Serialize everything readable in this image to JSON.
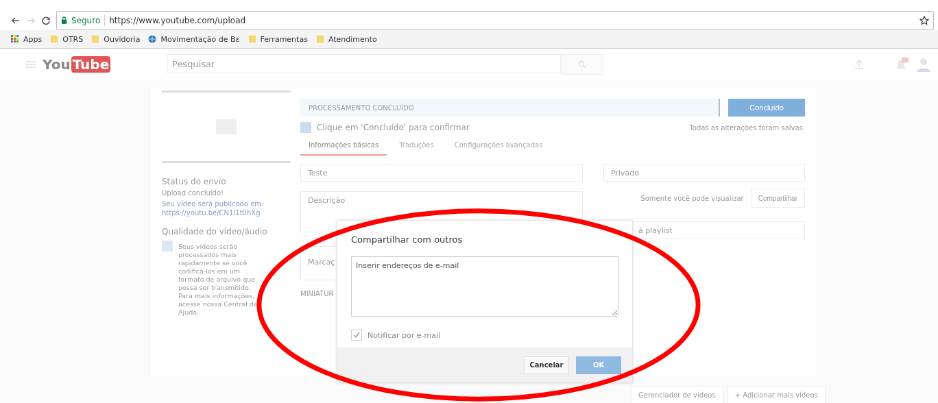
{
  "browser": {
    "secure_label": "Seguro",
    "url": "https://www.youtube.com/upload",
    "bookmarks": [
      {
        "kind": "apps",
        "label": "Apps"
      },
      {
        "kind": "folder",
        "label": "OTRS"
      },
      {
        "kind": "folder",
        "label": "Ouvidoria"
      },
      {
        "kind": "site",
        "label": "Movimentação de Bɛ"
      },
      {
        "kind": "folder",
        "label": "Ferramentas"
      },
      {
        "kind": "folder",
        "label": "Atendimento"
      }
    ]
  },
  "header": {
    "logo": [
      "You",
      "Tube"
    ],
    "search": {
      "placeholder": "Pesquisar"
    }
  },
  "upload": {
    "status_title": "Status do envio",
    "status_text": "Upload concluído!",
    "link_text": "Seu vídeo será publicado em: https://youtu.be/CN1I1t0hXg",
    "quality_title": "Qualidade do vídeo/áudio",
    "quality_text": "Seus vídeos serão processados mais rapidamente se você codificá-los em um formato de arquivo que possa ser transmitido. Para mais informações, acesse nossa Central de Ajuda.",
    "progress": {
      "label": "PROCESSAMENTO CONCLUÍDO",
      "level": 1
    },
    "done_button": "Concluído",
    "hint": "Clique em 'Concluído' para confirmar",
    "saved": "Todas as alterações foram salvas.",
    "tabs": [
      {
        "label": "Informações básicas",
        "selected": true
      },
      {
        "label": "Traduções",
        "selected": false
      },
      {
        "label": "Configurações avançadas",
        "selected": false
      }
    ],
    "title_value": "Teste",
    "description_placeholder": "Descrição",
    "tags_placeholder": "Marcaç",
    "thumbnails_label": "MINIATUR",
    "privacy": "Privado",
    "privacy_note": "Somente você pode visualizar",
    "share_button": "Compartilhar",
    "playlist_button": "à playlist"
  },
  "footer_buttons": [
    "Gerenciador de vídeos",
    "+ Adicionar mais vídeos"
  ],
  "dialog": {
    "title": "Compartilhar com outros",
    "emails_placeholder": "Inserir endereços de e-mail",
    "notify": {
      "label": "Notificar por e-mail",
      "checked": true
    },
    "buttons": [
      {
        "kind": "secondary",
        "label": "Cancelar"
      },
      {
        "kind": "primary",
        "label": "OK"
      }
    ]
  }
}
